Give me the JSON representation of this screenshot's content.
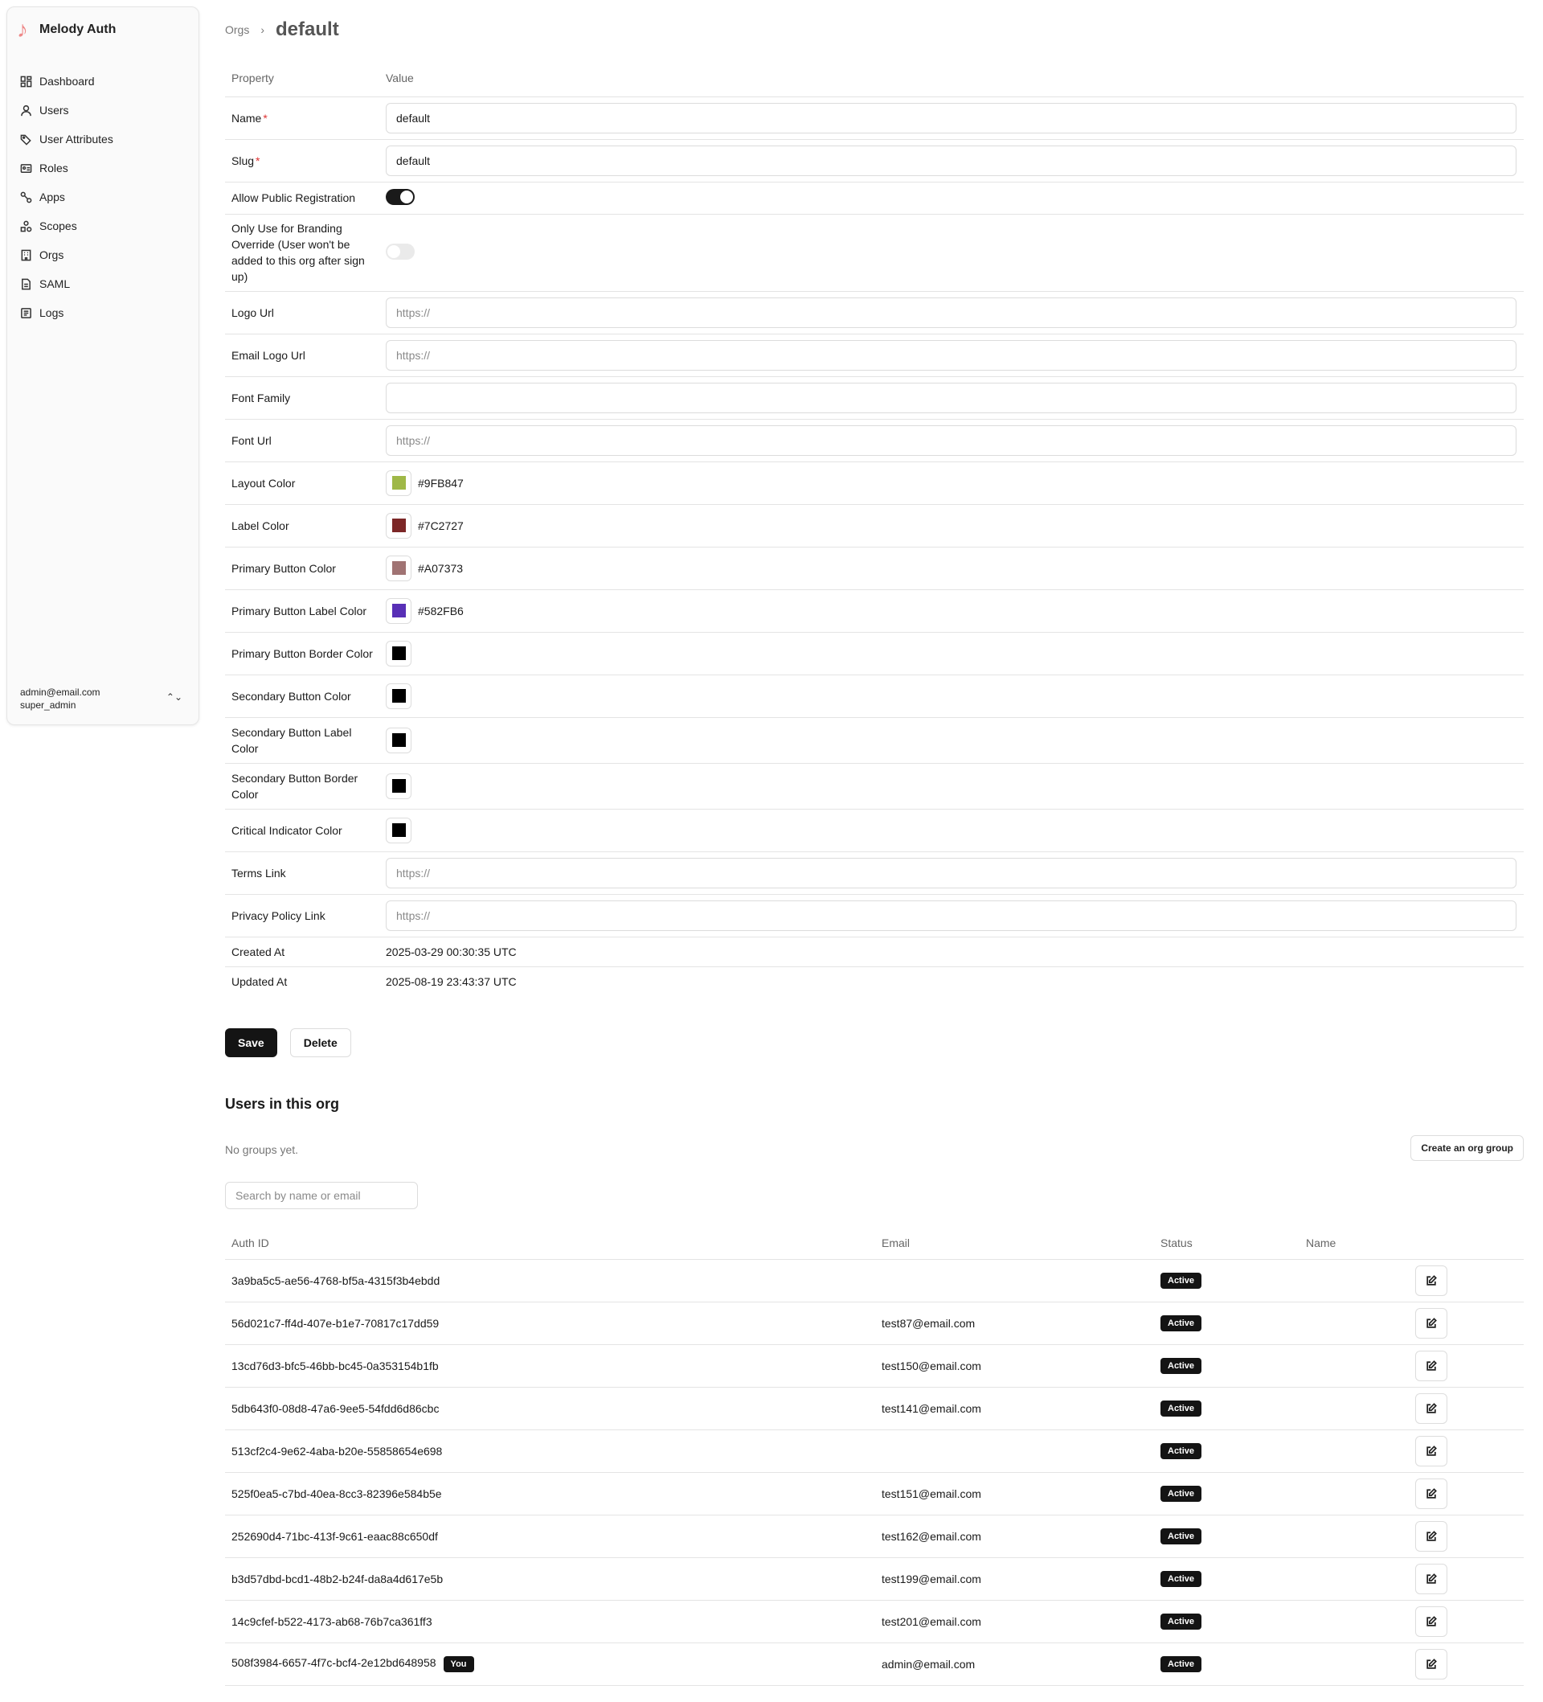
{
  "app": {
    "title": "Melody Auth",
    "logo_icon": "music-note-icon",
    "logo_color": "#E88A8A"
  },
  "sidebar": {
    "items": [
      {
        "label": "Dashboard",
        "icon": "dashboard-icon"
      },
      {
        "label": "Users",
        "icon": "user-icon"
      },
      {
        "label": "User Attributes",
        "icon": "tag-icon"
      },
      {
        "label": "Roles",
        "icon": "id-card-icon"
      },
      {
        "label": "Apps",
        "icon": "link-icon"
      },
      {
        "label": "Scopes",
        "icon": "shapes-icon"
      },
      {
        "label": "Orgs",
        "icon": "building-icon"
      },
      {
        "label": "SAML",
        "icon": "file-icon"
      },
      {
        "label": "Logs",
        "icon": "logs-icon"
      }
    ],
    "account": {
      "email": "admin@email.com",
      "role": "super_admin",
      "switch_icon": "chevron-up-down-icon"
    }
  },
  "breadcrumb": {
    "parent": "Orgs",
    "separator": "›",
    "current": "default"
  },
  "props": {
    "header_property": "Property",
    "header_value": "Value",
    "name": {
      "label": "Name",
      "required": "*",
      "value": "default"
    },
    "slug": {
      "label": "Slug",
      "required": "*",
      "value": "default"
    },
    "allow_public_registration": {
      "label": "Allow Public Registration",
      "on": true
    },
    "branding_override": {
      "label": "Only Use for Branding Override (User won't be added to this org after sign up)",
      "on": false
    },
    "logo_url": {
      "label": "Logo Url",
      "placeholder": "https://"
    },
    "email_logo_url": {
      "label": "Email Logo Url",
      "placeholder": "https://"
    },
    "font_family": {
      "label": "Font Family",
      "value": ""
    },
    "font_url": {
      "label": "Font Url",
      "placeholder": "https://"
    },
    "layout_color": {
      "label": "Layout Color",
      "hex": "#9FB847",
      "color": "#9FB847"
    },
    "label_color": {
      "label": "Label Color",
      "hex": "#7C2727",
      "color": "#7C2727"
    },
    "primary_button_color": {
      "label": "Primary Button Color",
      "hex": "#A07373",
      "color": "#A07373"
    },
    "primary_button_label_color": {
      "label": "Primary Button Label Color",
      "hex": "#582FB6",
      "color": "#582FB6"
    },
    "primary_button_border_color": {
      "label": "Primary Button Border Color",
      "hex": "",
      "color": "#000000"
    },
    "secondary_button_color": {
      "label": "Secondary Button Color",
      "hex": "",
      "color": "#000000"
    },
    "secondary_button_label_color": {
      "label": "Secondary Button Label Color",
      "hex": "",
      "color": "#000000"
    },
    "secondary_button_border_color": {
      "label": "Secondary Button Border Color",
      "hex": "",
      "color": "#000000"
    },
    "critical_indicator_color": {
      "label": "Critical Indicator Color",
      "hex": "",
      "color": "#000000"
    },
    "terms_link": {
      "label": "Terms Link",
      "placeholder": "https://"
    },
    "privacy_policy_link": {
      "label": "Privacy Policy Link",
      "placeholder": "https://"
    },
    "created_at": {
      "label": "Created At",
      "value": "2025-03-29 00:30:35 UTC"
    },
    "updated_at": {
      "label": "Updated At",
      "value": "2025-08-19 23:43:37 UTC"
    }
  },
  "actions": {
    "save": "Save",
    "delete": "Delete"
  },
  "users_section": {
    "title": "Users in this org",
    "no_groups": "No groups yet.",
    "create_group": "Create an org group",
    "search_placeholder": "Search by name or email",
    "columns": {
      "auth_id": "Auth ID",
      "email": "Email",
      "status": "Status",
      "name": "Name"
    },
    "rows": [
      {
        "auth_id": "3a9ba5c5-ae56-4768-bf5a-4315f3b4ebdd",
        "email": "",
        "status": "Active",
        "name": "",
        "you": ""
      },
      {
        "auth_id": "56d021c7-ff4d-407e-b1e7-70817c17dd59",
        "email": "test87@email.com",
        "status": "Active",
        "name": "",
        "you": ""
      },
      {
        "auth_id": "13cd76d3-bfc5-46bb-bc45-0a353154b1fb",
        "email": "test150@email.com",
        "status": "Active",
        "name": "",
        "you": ""
      },
      {
        "auth_id": "5db643f0-08d8-47a6-9ee5-54fdd6d86cbc",
        "email": "test141@email.com",
        "status": "Active",
        "name": "",
        "you": ""
      },
      {
        "auth_id": "513cf2c4-9e62-4aba-b20e-55858654e698",
        "email": "",
        "status": "Active",
        "name": "",
        "you": ""
      },
      {
        "auth_id": "525f0ea5-c7bd-40ea-8cc3-82396e584b5e",
        "email": "test151@email.com",
        "status": "Active",
        "name": "",
        "you": ""
      },
      {
        "auth_id": "252690d4-71bc-413f-9c61-eaac88c650df",
        "email": "test162@email.com",
        "status": "Active",
        "name": "",
        "you": ""
      },
      {
        "auth_id": "b3d57dbd-bcd1-48b2-b24f-da8a4d617e5b",
        "email": "test199@email.com",
        "status": "Active",
        "name": "",
        "you": ""
      },
      {
        "auth_id": "14c9cfef-b522-4173-ab68-76b7ca361ff3",
        "email": "test201@email.com",
        "status": "Active",
        "name": "",
        "you": ""
      },
      {
        "auth_id": "508f3984-6657-4f7c-bcf4-2e12bd648958",
        "email": "admin@email.com",
        "status": "Active",
        "name": "",
        "you": "You"
      }
    ]
  }
}
